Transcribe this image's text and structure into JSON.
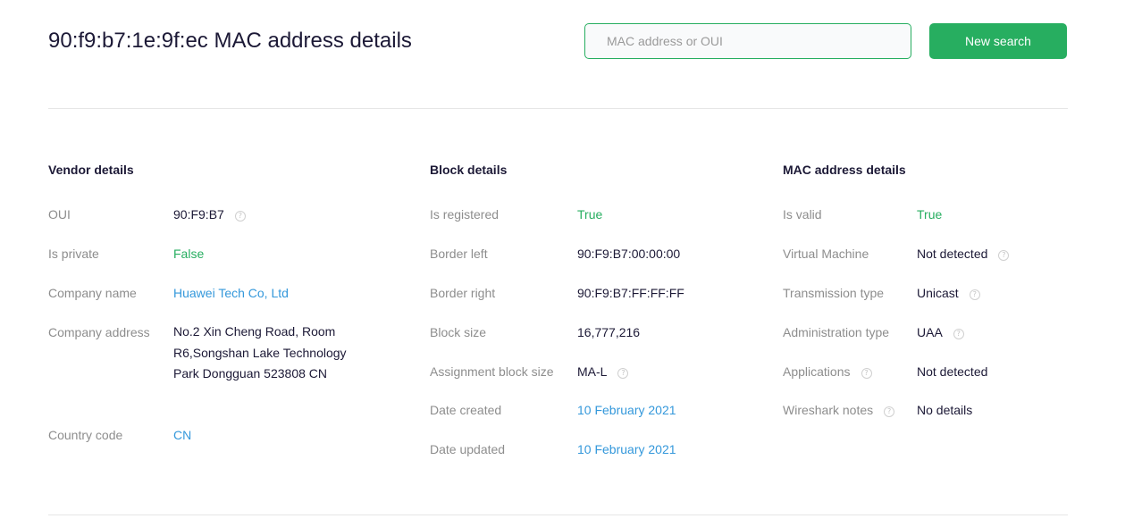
{
  "header": {
    "title": "90:f9:b7:1e:9f:ec MAC address details",
    "search_placeholder": "MAC address or OUI",
    "search_value": "",
    "search_button_label": "New search"
  },
  "vendor": {
    "title": "Vendor details",
    "oui_label": "OUI",
    "oui_value": "90:F9:B7",
    "private_label": "Is private",
    "private_value": "False",
    "company_label": "Company name",
    "company_value": "Huawei Tech Co, Ltd",
    "address_label": "Company address",
    "address_value": "No.2 Xin Cheng Road, Room R6,Songshan Lake Technology Park Dongguan 523808 CN",
    "country_label": "Country code",
    "country_value": "CN"
  },
  "block": {
    "title": "Block details",
    "registered_label": "Is registered",
    "registered_value": "True",
    "border_left_label": "Border left",
    "border_left_value": "90:F9:B7:00:00:00",
    "border_right_label": "Border right",
    "border_right_value": "90:F9:B7:FF:FF:FF",
    "size_label": "Block size",
    "size_value": "16,777,216",
    "assignment_label": "Assignment block size",
    "assignment_value": "MA-L",
    "created_label": "Date created",
    "created_value": "10 February 2021",
    "updated_label": "Date updated",
    "updated_value": "10 February 2021"
  },
  "mac": {
    "title": "MAC address details",
    "valid_label": "Is valid",
    "valid_value": "True",
    "vm_label": "Virtual Machine",
    "vm_value": "Not detected",
    "transmission_label": "Transmission type",
    "transmission_value": "Unicast",
    "admin_label": "Administration type",
    "admin_value": "UAA",
    "applications_label": "Applications",
    "applications_value": "Not detected",
    "wireshark_label": "Wireshark notes",
    "wireshark_value": "No details"
  },
  "icons": {
    "help": "?"
  },
  "colors": {
    "accent": "#27ae60",
    "link": "#3498db",
    "label": "#8d8d8d",
    "text": "#1c1936"
  }
}
